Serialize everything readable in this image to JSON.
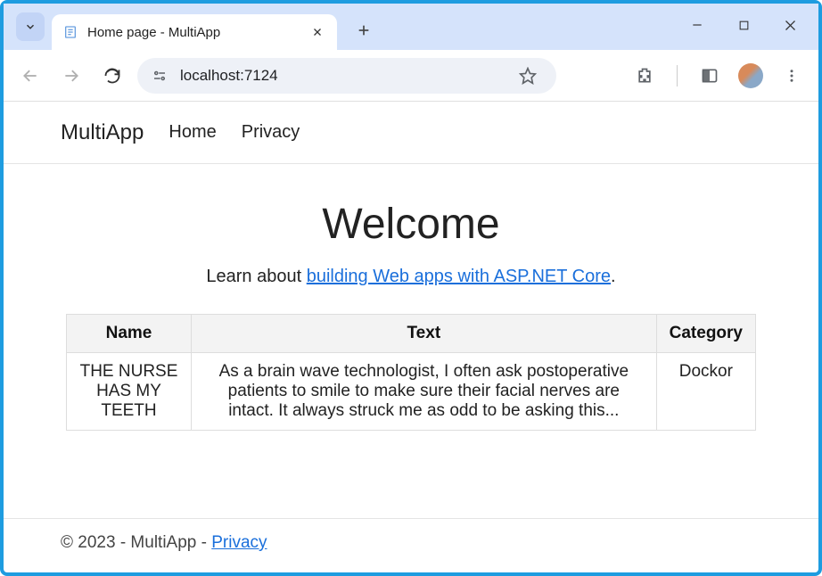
{
  "browser": {
    "tab_title": "Home page - MultiApp",
    "url": "localhost:7124"
  },
  "navbar": {
    "brand": "MultiApp",
    "links": [
      "Home",
      "Privacy"
    ]
  },
  "content": {
    "heading": "Welcome",
    "learn_prefix": "Learn about ",
    "learn_link": "building Web apps with ASP.NET Core",
    "learn_suffix": "."
  },
  "table": {
    "headers": [
      "Name",
      "Text",
      "Category"
    ],
    "rows": [
      {
        "name": "THE NURSE HAS MY TEETH",
        "text": "As a brain wave technologist, I often ask postoperative patients to smile to make sure their facial nerves are intact. It always struck me as odd to be asking this...",
        "category": "Dockor"
      }
    ]
  },
  "footer": {
    "copyright": "© 2023 - MultiApp - ",
    "privacy_link": "Privacy"
  }
}
